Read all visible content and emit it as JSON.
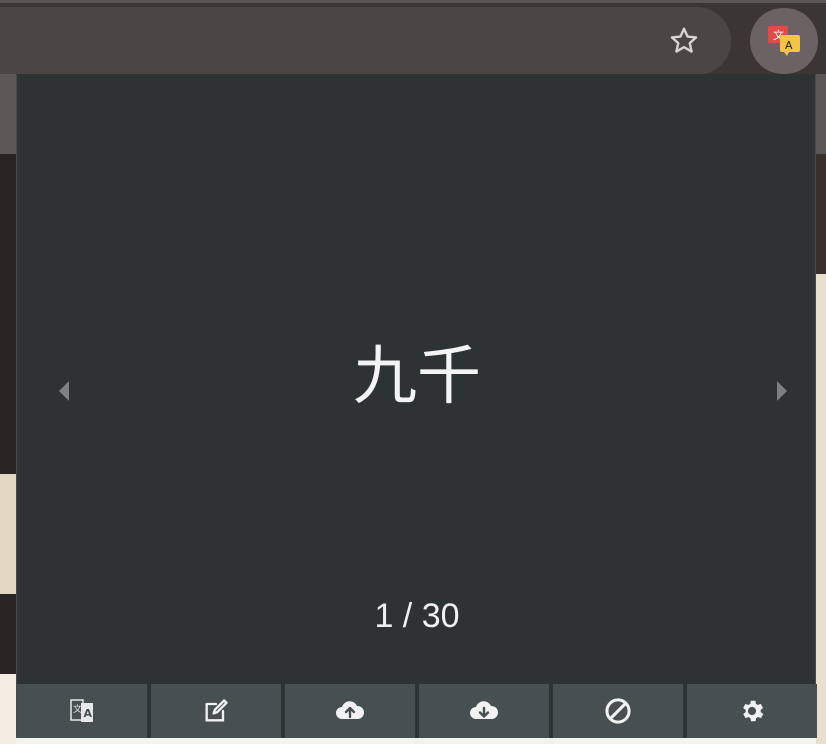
{
  "browser": {
    "bookmark_icon": "star-outline-icon",
    "extension_icon": "translate-extension-icon"
  },
  "card": {
    "text": "九千",
    "counter": "1 / 30"
  },
  "navigation": {
    "prev_icon": "caret-left-icon",
    "next_icon": "caret-right-icon"
  },
  "actions": [
    {
      "name": "translate",
      "icon": "translate-icon"
    },
    {
      "name": "edit",
      "icon": "edit-icon"
    },
    {
      "name": "upload",
      "icon": "cloud-upload-icon"
    },
    {
      "name": "download",
      "icon": "cloud-download-icon"
    },
    {
      "name": "block",
      "icon": "block-icon"
    },
    {
      "name": "settings",
      "icon": "gear-icon"
    }
  ],
  "colors": {
    "popup_bg": "#2d3233",
    "button_bg": "#474f50",
    "text": "#f4f4f4"
  }
}
